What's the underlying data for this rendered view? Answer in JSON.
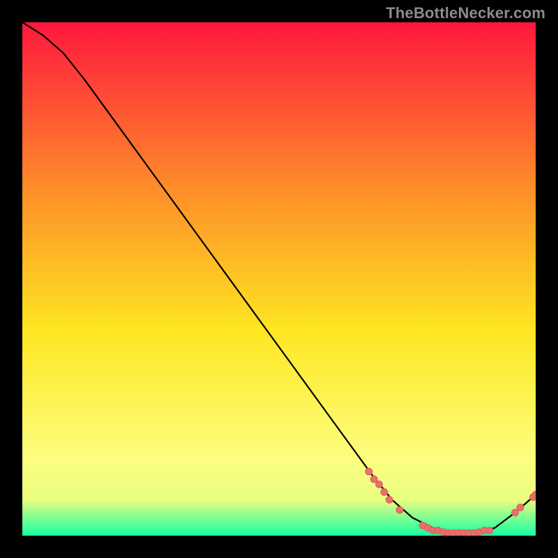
{
  "watermark_text": "TheBottleNecker.com",
  "colors": {
    "gradient_top": "#fe173e",
    "gradient_upper_mid": "#fe8f29",
    "gradient_mid": "#fee621",
    "gradient_lower_soft": "#fdfe7f",
    "gradient_lower_band": "#eafe80",
    "gradient_bottom": "#14ffa3",
    "background": "#000000",
    "curve": "#000000",
    "point_fill": "#ea6f6b",
    "point_stroke": "#d65a57"
  },
  "chart_data": {
    "type": "line",
    "title": "",
    "xlabel": "",
    "ylabel": "",
    "xlim": [
      0,
      100
    ],
    "ylim": [
      0,
      100
    ],
    "curve": {
      "x": [
        0,
        4,
        8,
        12,
        16,
        20,
        24,
        28,
        32,
        36,
        40,
        44,
        48,
        52,
        56,
        60,
        64,
        68,
        72,
        76,
        80,
        84,
        88,
        92,
        96,
        100
      ],
      "y": [
        100,
        97.5,
        94,
        89,
        83.5,
        78,
        72.5,
        67,
        61.5,
        56,
        50.5,
        45,
        39.5,
        34,
        28.5,
        23,
        17.5,
        12,
        7,
        3.5,
        1.5,
        0.5,
        0.5,
        1.5,
        4.5,
        8
      ]
    },
    "points": [
      {
        "x": 67.5,
        "y": 12.5
      },
      {
        "x": 68.5,
        "y": 11
      },
      {
        "x": 69.5,
        "y": 10
      },
      {
        "x": 70.5,
        "y": 8.5
      },
      {
        "x": 71.5,
        "y": 7
      },
      {
        "x": 73.5,
        "y": 5
      },
      {
        "x": 78.0,
        "y": 2
      },
      {
        "x": 79.0,
        "y": 1.5
      },
      {
        "x": 80.0,
        "y": 1
      },
      {
        "x": 81.0,
        "y": 1
      },
      {
        "x": 82.0,
        "y": 0.7
      },
      {
        "x": 83.0,
        "y": 0.5
      },
      {
        "x": 84.0,
        "y": 0.5
      },
      {
        "x": 85.0,
        "y": 0.5
      },
      {
        "x": 86.0,
        "y": 0.5
      },
      {
        "x": 87.0,
        "y": 0.5
      },
      {
        "x": 88.0,
        "y": 0.5
      },
      {
        "x": 89.0,
        "y": 0.7
      },
      {
        "x": 90.0,
        "y": 1
      },
      {
        "x": 91.0,
        "y": 1
      },
      {
        "x": 96.0,
        "y": 4.5
      },
      {
        "x": 97.0,
        "y": 5.5
      },
      {
        "x": 99.5,
        "y": 7.5
      },
      {
        "x": 100.0,
        "y": 8
      }
    ],
    "overlap_label": {
      "text": "",
      "x": 84,
      "y": 1.5
    }
  }
}
